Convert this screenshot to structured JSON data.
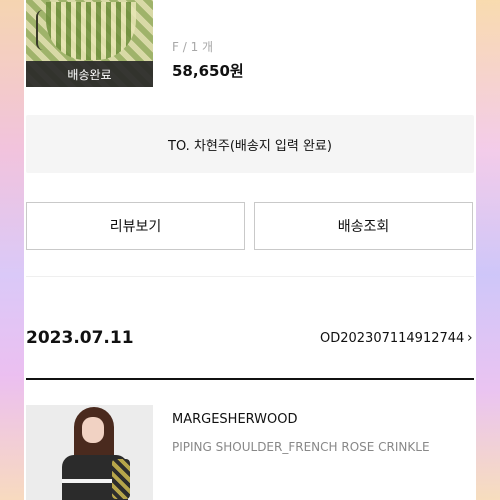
{
  "order_prev": {
    "item": {
      "status_label": "배송완료",
      "option": "F / 1 개",
      "price": "58,650원"
    },
    "shipping": {
      "recipient_text": "TO. 차현주(배송지 입력 완료)"
    },
    "actions": {
      "review_label": "리뷰보기",
      "track_label": "배송조회"
    }
  },
  "order": {
    "date": "2023.07.11",
    "number": "OD202307114912744",
    "chevron": "›",
    "item": {
      "brand": "MARGESHERWOOD",
      "name": "PIPING SHOULDER_FRENCH ROSE CRINKLE"
    }
  },
  "colors": {
    "accent_dark": "#111111",
    "muted_text": "#888888",
    "panel_bg": "#f5f5f5"
  },
  "icons": {
    "order_link": "chevron-right-icon"
  }
}
